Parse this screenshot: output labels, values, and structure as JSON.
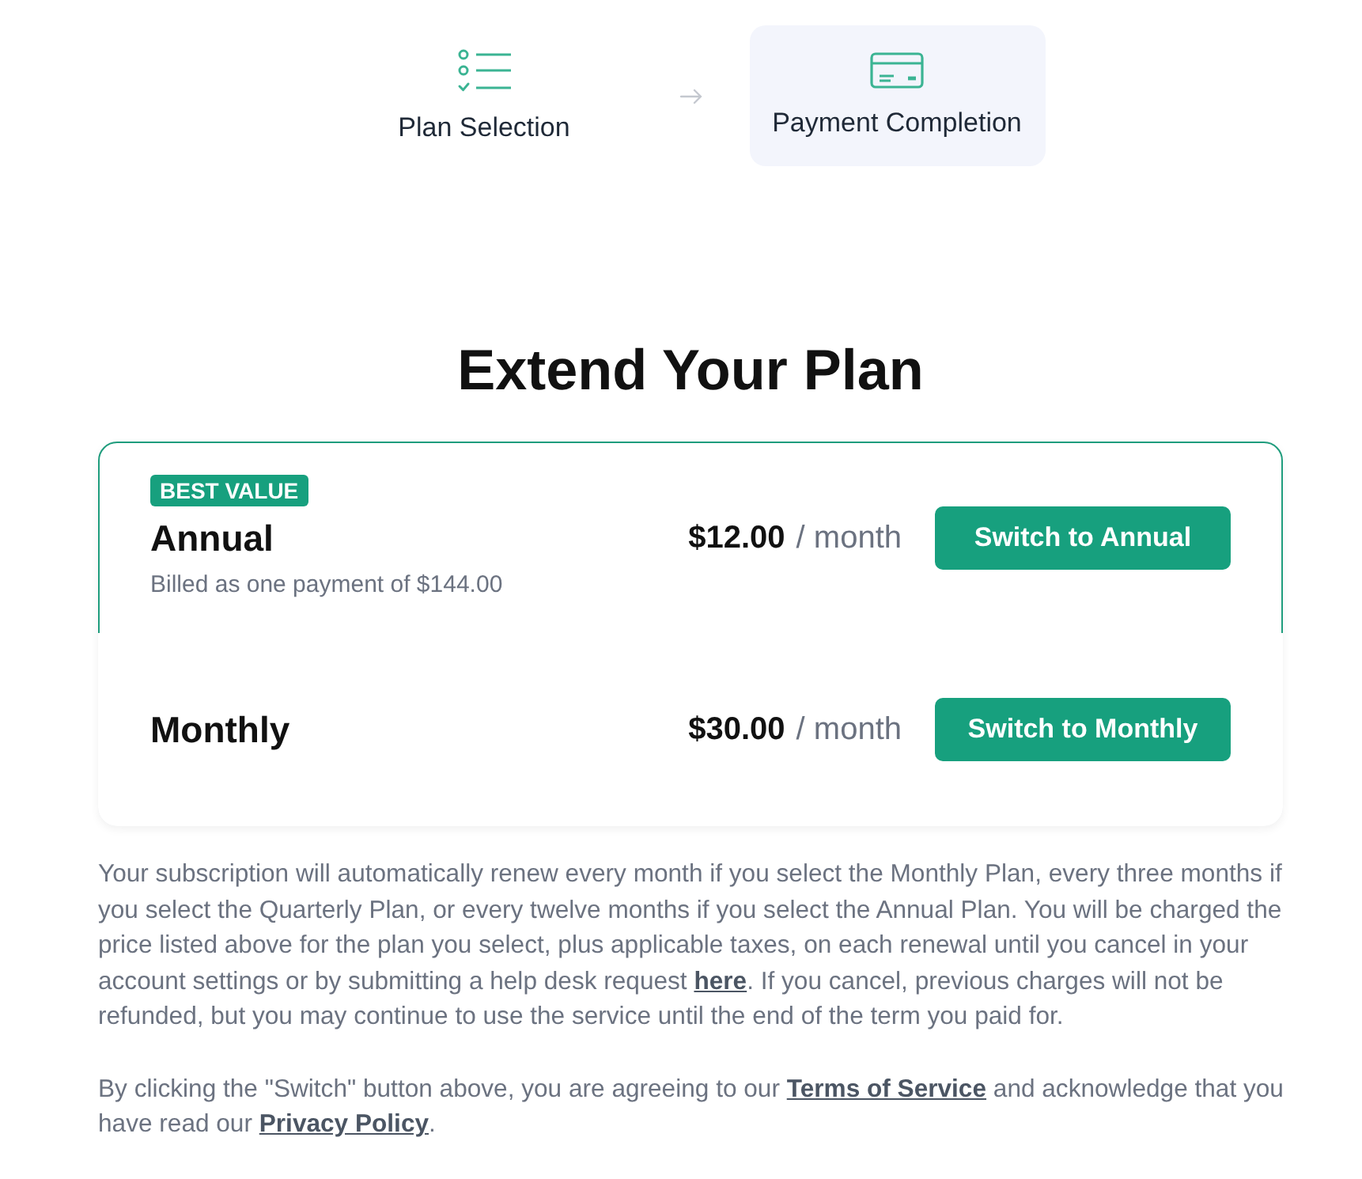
{
  "steps": [
    {
      "kind": "checklist",
      "label": "Plan Selection",
      "selected": false
    },
    {
      "kind": "card",
      "label": "Payment Completion",
      "selected": true
    }
  ],
  "heading": "Extend Your Plan",
  "plans": [
    {
      "badge": "BEST VALUE",
      "name": "Annual",
      "note": "Billed as one payment of $144.00",
      "price": "$12.00",
      "period": "/ month",
      "button": "Switch to Annual",
      "selected": true
    },
    {
      "name": "Monthly",
      "price": "$30.00",
      "period": "/ month",
      "button": "Switch to Monthly",
      "selected": false
    }
  ],
  "disclaimer": [
    {
      "parts": [
        {
          "kind": "text",
          "text": "Your subscription will automatically renew every month if you select the Monthly Plan, every three months if you select the Quarterly Plan, or every twelve months if you select the Annual Plan. You will be charged the price listed above for the plan you select, plus applicable taxes, on each renewal until you cancel in your account settings or by submitting a help desk request "
        },
        {
          "kind": "link",
          "text": "here"
        },
        {
          "kind": "text",
          "text": ". If you cancel, previous charges will not be refunded, but you may continue to use the service until the end of the term you paid for."
        }
      ]
    },
    {
      "parts": [
        {
          "kind": "text",
          "text": "By clicking the \"Switch\" button above, you are agreeing to our "
        },
        {
          "kind": "link",
          "text": "Terms of Service"
        },
        {
          "kind": "text",
          "text": " and acknowledge that you have read our "
        },
        {
          "kind": "link",
          "text": "Privacy Policy"
        },
        {
          "kind": "text",
          "text": "."
        }
      ]
    }
  ]
}
